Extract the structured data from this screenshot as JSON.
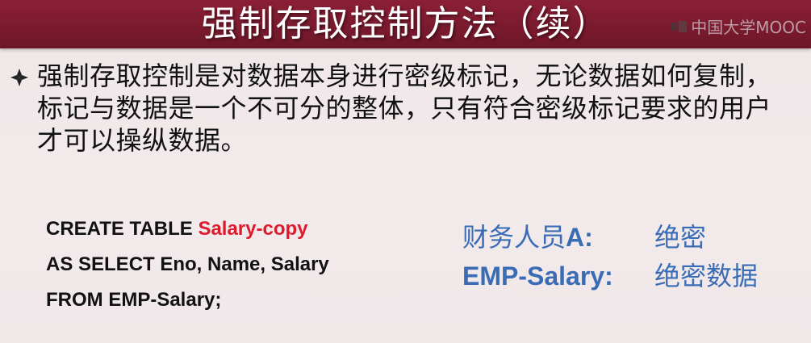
{
  "slide": {
    "title": "强制存取控制方法（续）",
    "watermark": "中国大学MOOC",
    "paragraph": "强制存取控制是对数据本身进行密级标记，无论数据如何复制，标记与数据是一个不可分的整体，只有符合密级标记要求的用户才可以操纵数据。",
    "code": {
      "line1_prefix": "CREATE TABLE ",
      "line1_highlight": "Salary-copy",
      "line2": "AS SELECT  Eno, Name, Salary",
      "line3": "FROM EMP-Salary;"
    },
    "info": {
      "row1_label_cn": "财务人员",
      "row1_label_en": "A:",
      "row1_value": "绝密",
      "row2_label": "EMP-Salary:",
      "row2_value": "绝密数据"
    }
  },
  "colors": {
    "title_bar": "#7a1a2e",
    "highlight_red": "#e0192c",
    "info_blue": "#3a6cb5"
  }
}
